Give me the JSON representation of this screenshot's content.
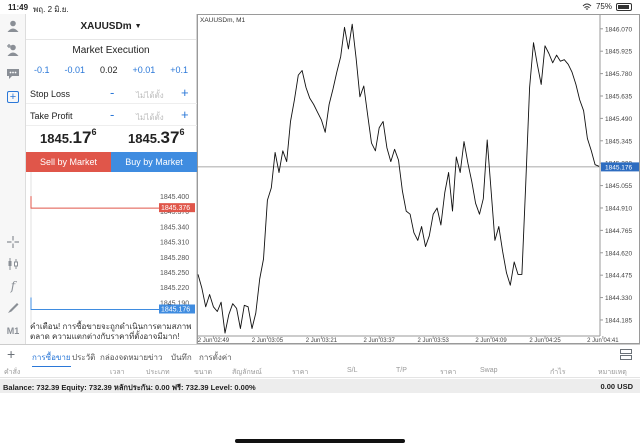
{
  "status_bar": {
    "time": "11:49",
    "date": "พฤ. 2 มิ.ย.",
    "battery": "75%",
    "battery_level": 0.75
  },
  "left_toolbar": [
    {
      "icon": "person-icon"
    },
    {
      "icon": "person-add-icon"
    },
    {
      "icon": "chat-icon"
    },
    {
      "icon": "new-order-icon",
      "active": true
    },
    {
      "icon": "crosshair-icon"
    },
    {
      "icon": "candlestick-icon"
    },
    {
      "icon": "function-icon"
    },
    {
      "icon": "drawing-icon"
    },
    {
      "label": "M1"
    }
  ],
  "trade": {
    "symbol": "XAUUSDm",
    "execution": "Market Execution",
    "volume_steps_left": [
      "-0.1",
      "-0.01"
    ],
    "volume": "0.02",
    "volume_steps_right": [
      "+0.01",
      "+0.1"
    ],
    "stop_loss_label": "Stop Loss",
    "take_profit_label": "Take Profit",
    "not_set": "ไม่ได้ตั้ง",
    "bid": {
      "prefix": "1845.",
      "big": "17",
      "sup": "6"
    },
    "ask": {
      "prefix": "1845.",
      "big": "37",
      "sup": "6"
    },
    "sell_label": "Sell by Market",
    "buy_label": "Buy by Market",
    "warning": "คำเตือน! การซื้อขายจะถูกดำเนินการตามสภาพตลาด ความแตกต่างกับราคาที่ตั้งอาจมีมาก!"
  },
  "tick_chart": {
    "labels": [
      "1845.400",
      "1845.370",
      "1845.340",
      "1845.310",
      "1845.280",
      "1845.250",
      "1845.220",
      "1845.190"
    ],
    "ask_tag": "1845.376",
    "bid_tag": "1845.176",
    "ask_value": 1845.376,
    "bid_value": 1845.176
  },
  "chart_data": {
    "type": "line",
    "title": "XAUUSDm, M1",
    "xlabel": "",
    "ylabel": "",
    "x_ticks": [
      "2 Jun 02:49",
      "2 Jun 03:05",
      "2 Jun 03:21",
      "2 Jun 03:37",
      "2 Jun 03:53",
      "2 Jun 04:09",
      "2 Jun 04:25",
      "2 Jun 04:41"
    ],
    "y_ticks": [
      "1846.070",
      "1845.925",
      "1845.780",
      "1845.635",
      "1845.490",
      "1845.345",
      "1845.200",
      "1845.055",
      "1844.910",
      "1844.765",
      "1844.620",
      "1844.475",
      "1844.330",
      "1844.185"
    ],
    "ylim": [
      1844.12,
      1846.14
    ],
    "current_price_label": "1845.176",
    "current_price": 1845.176,
    "grid": false,
    "y": [
      1844.48,
      1844.39,
      1844.27,
      1844.35,
      1844.27,
      1844.24,
      1844.3,
      1844.1,
      1844.22,
      1844.29,
      1844.26,
      1844.13,
      1844.28,
      1844.27,
      1844.13,
      1844.23,
      1844.45,
      1844.58,
      1844.96,
      1845.04,
      1845.27,
      1845.14,
      1845.28,
      1845.21,
      1845.47,
      1845.61,
      1845.77,
      1845.8,
      1845.69,
      1845.62,
      1845.58,
      1845.53,
      1845.48,
      1845.4,
      1845.58,
      1845.68,
      1845.79,
      1845.89,
      1846.08,
      1845.94,
      1846.1,
      1845.88,
      1845.63,
      1845.7,
      1845.51,
      1845.33,
      1845.28,
      1845.43,
      1845.47,
      1845.3,
      1845.21,
      1845.29,
      1845.22,
      1845.02,
      1844.89,
      1844.87,
      1844.75,
      1844.7,
      1844.79,
      1844.66,
      1844.73,
      1844.87,
      1844.91,
      1844.8,
      1845.01,
      1845.14,
      1844.89,
      1845.24,
      1845.14,
      1845.34,
      1845.2,
      1845.08,
      1844.94,
      1844.87,
      1844.97,
      1845.35,
      1845.03,
      1844.7,
      1844.79,
      1844.63,
      1844.49,
      1844.41,
      1844.56,
      1844.48,
      1844.48,
      1845.06,
      1845.69,
      1845.98,
      1845.84,
      1845.71,
      1845.96,
      1845.91,
      1845.85,
      1845.9,
      1845.86,
      1845.87,
      1845.84,
      1845.79,
      1845.71,
      1845.61,
      1845.54,
      1845.36,
      1845.28,
      1845.19,
      1845.18
    ]
  },
  "tabs": {
    "items": [
      "การซื้อขาย",
      "ประวัติ",
      "กล่องจดหมาย",
      "ข่าว",
      "บันทึก",
      "การตั้งค่า"
    ],
    "active": 0
  },
  "columns": [
    "คำสั่ง",
    "เวลา",
    "ประเภท",
    "ขนาด",
    "สัญลักษณ์",
    "ราคา",
    "S/L",
    "T/P",
    "ราคา",
    "Swap",
    "กำไร",
    "หมายเหตุ"
  ],
  "account": {
    "summary": "Balance: 732.39 Equity: 732.39 หลักประกัน: 0.00 ฟรี: 732.39 Level: 0.00%",
    "profit": "0.00 USD"
  }
}
